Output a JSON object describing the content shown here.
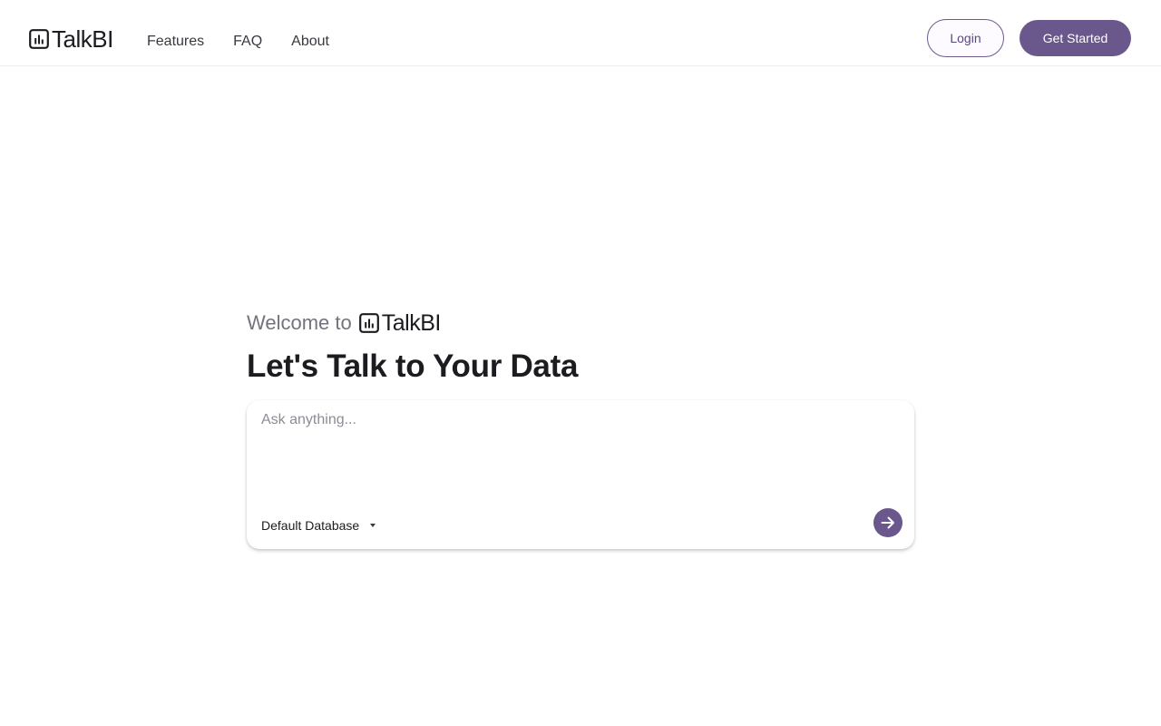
{
  "brand": {
    "name": "TalkBI",
    "icon": "bar-chart-box-icon"
  },
  "nav": {
    "items": [
      {
        "label": "Features"
      },
      {
        "label": "FAQ"
      },
      {
        "label": "About"
      }
    ]
  },
  "header_actions": {
    "login_label": "Login",
    "get_started_label": "Get Started"
  },
  "hero": {
    "welcome_text": "Welcome to",
    "brand_name": "TalkBI",
    "headline": "Let's Talk to Your Data"
  },
  "prompt": {
    "value": "",
    "placeholder": "Ask anything...",
    "database_label": "Default Database",
    "database_dropdown_icon": "caret-down-icon",
    "send_icon": "arrow-right-icon"
  },
  "colors": {
    "accent": "#6a578c",
    "accent_text": "#5b4780",
    "text": "#1c1b1f",
    "muted_text": "#76727c",
    "divider": "#eeeaf1"
  }
}
